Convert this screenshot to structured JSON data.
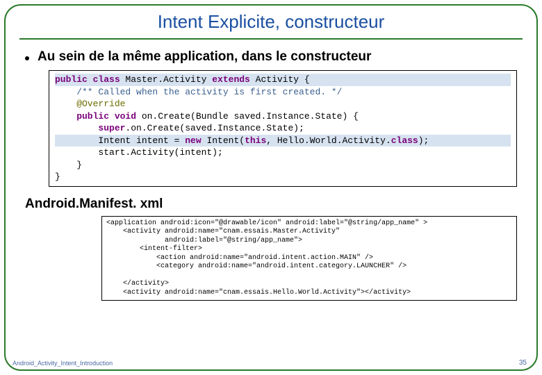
{
  "title": "Intent Explicite, constructeur",
  "bullet1": "Au sein de la même application, dans le constructeur",
  "java": {
    "l1a": "public class",
    "l1b": " Master.Activity ",
    "l1c": "extends",
    "l1d": " Activity {",
    "l2": "    /** Called when the activity is first created. */",
    "l3": "    @Override",
    "l4a": "    public void",
    "l4b": " on.Create(Bundle saved.Instance.State) {",
    "l5a": "        super",
    "l5b": ".on.Create(saved.Instance.State);",
    "l6a": "        Intent intent = ",
    "l6b": "new",
    "l6c": " Intent(",
    "l6d": "this",
    "l6e": ", Hello.World.Activity.",
    "l6f": "class",
    "l6g": ");",
    "l7": "        start.Activity(intent);",
    "l8": "    }",
    "l9": "}"
  },
  "subheading": "Android.Manifest. xml",
  "xml": {
    "l1": "<application android:icon=\"@drawable/icon\" android:label=\"@string/app_name\" >",
    "l2": "    <activity android:name=\"cnam.essais.Master.Activity\"",
    "l3": "              android:label=\"@string/app_name\">",
    "l4": "        <intent-filter>",
    "l5": "            <action android:name=\"android.intent.action.MAIN\" />",
    "l6": "            <category android:name=\"android.intent.category.LAUNCHER\" />",
    "l7": "",
    "l8": "    </activity>",
    "l9": "    <activity android:name=\"cnam.essais.Hello.World.Activity\"></activity>"
  },
  "footer_left": "Android_Activity_Intent_Introduction",
  "footer_right": "35"
}
